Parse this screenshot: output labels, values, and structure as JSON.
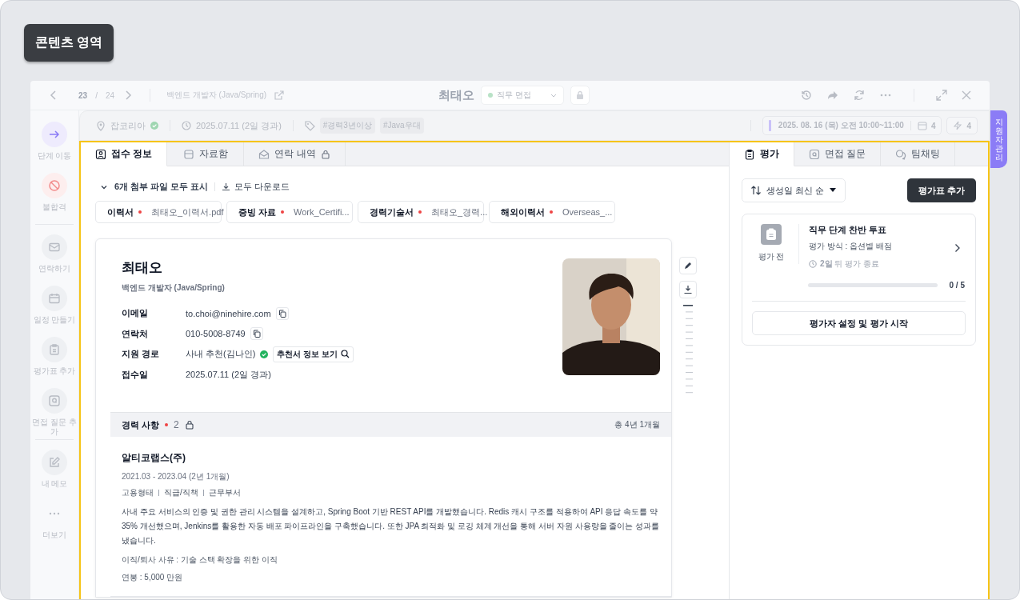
{
  "area_label": "콘텐츠 영역",
  "topbar": {
    "page_current": "23",
    "page_sep": "/",
    "page_total": "24",
    "job": "백엔드 개발자 (Java/Spring)",
    "name": "최태오",
    "stage": "직무 면접"
  },
  "infobar": {
    "source": "잡코리아",
    "date": "2025.07.11 (2일 경과)",
    "tags": [
      "#경력3년이상",
      "#Java우대"
    ],
    "schedule": "2025. 08. 16 (목) 오전 10:00~11:00",
    "calendar_count": "4",
    "flash_count": "4"
  },
  "side_tab": "지원자 관리",
  "rail_groups": [
    {
      "items": [
        {
          "label": "단계 이동",
          "kind": "move"
        },
        {
          "label": "불합격",
          "kind": "reject"
        }
      ]
    },
    {
      "items": [
        {
          "label": "연락하기",
          "kind": "mail"
        },
        {
          "label": "일정 만들기",
          "kind": "calendar"
        },
        {
          "label": "평가표 추가",
          "kind": "clipboard"
        },
        {
          "label": "면접 질문 추가",
          "kind": "question"
        }
      ]
    },
    {
      "items": [
        {
          "label": "내 메모",
          "kind": "memo"
        },
        {
          "label": "더보기",
          "kind": "more"
        }
      ]
    }
  ],
  "left_tabs": [
    {
      "label": "접수 정보",
      "kind": "person",
      "selected": true,
      "locked": false
    },
    {
      "label": "자료함",
      "kind": "box",
      "selected": false,
      "locked": false
    },
    {
      "label": "연락 내역",
      "kind": "mail",
      "selected": false,
      "locked": true
    }
  ],
  "attachments": {
    "toggle": "6개 첨부 파일 모두 표시",
    "download": "모두 다운로드",
    "files": [
      {
        "type": "이력서",
        "name": "최태오_이력서.pdf",
        "required": true
      },
      {
        "type": "증빙 자료",
        "name": "Work_Certifi...",
        "required": true
      },
      {
        "type": "경력기술서",
        "name": "최태오_경력...",
        "required": true
      },
      {
        "type": "해외이력서",
        "name": "Overseas_...",
        "required": true
      }
    ]
  },
  "profile": {
    "name": "최태오",
    "role": "백엔드 개발자 (Java/Spring)",
    "fields": [
      {
        "label": "이메일",
        "value": "to.choi@ninehire.com",
        "copy": true
      },
      {
        "label": "연락처",
        "value": "010-5008-8749",
        "copy": true
      },
      {
        "label": "지원 경로",
        "value": "사내 추천(김나인)",
        "verified": true,
        "action": "추천서 정보 보기"
      },
      {
        "label": "접수일",
        "value": "2025.07.11 (2일 경과)"
      }
    ]
  },
  "career": {
    "title": "경력 사항",
    "count": "2",
    "total": "총 4년 1개월",
    "entries": [
      {
        "company": "알티코랩스(주)",
        "period": "2021.03 - 2023.04 (2년 1개월)",
        "meta": [
          "고용형태",
          "직급/직책",
          "근무부서"
        ],
        "description": "사내 주요 서비스의 인증 및 권한 관리 시스템을 설계하고, Spring Boot 기반 REST API를 개발했습니다. Redis 캐시 구조를 적용하여 API 응답 속도를 약 35% 개선했으며, Jenkins를 활용한 자동 배포 파이프라인을 구축했습니다. 또한 JPA 최적화 및 로깅 체계 개선을 통해 서버 자원 사용량을 줄이는 성과를 냈습니다.",
        "reason": "이직/퇴사 사유 : 기술 스택 확장을 위한 이직",
        "salary": "연봉 : 5,000 만원"
      }
    ]
  },
  "right_tabs": [
    {
      "label": "평가",
      "kind": "clipboard",
      "selected": true
    },
    {
      "label": "면접 질문",
      "kind": "question",
      "selected": false
    },
    {
      "label": "팀채팅",
      "kind": "chat",
      "selected": false
    }
  ],
  "sort": "생성일 최신 순",
  "add_button": "평가표 추가",
  "eval_card": {
    "status": "평가 전",
    "title": "직무 단계 찬반 투표",
    "method": "평가 방식 : 옵션별 배점",
    "deadline": "**2일** 뒤 평가 종료",
    "level": 0,
    "count": "0 / 5",
    "button": "평가자 설정 및 평가 시작"
  }
}
